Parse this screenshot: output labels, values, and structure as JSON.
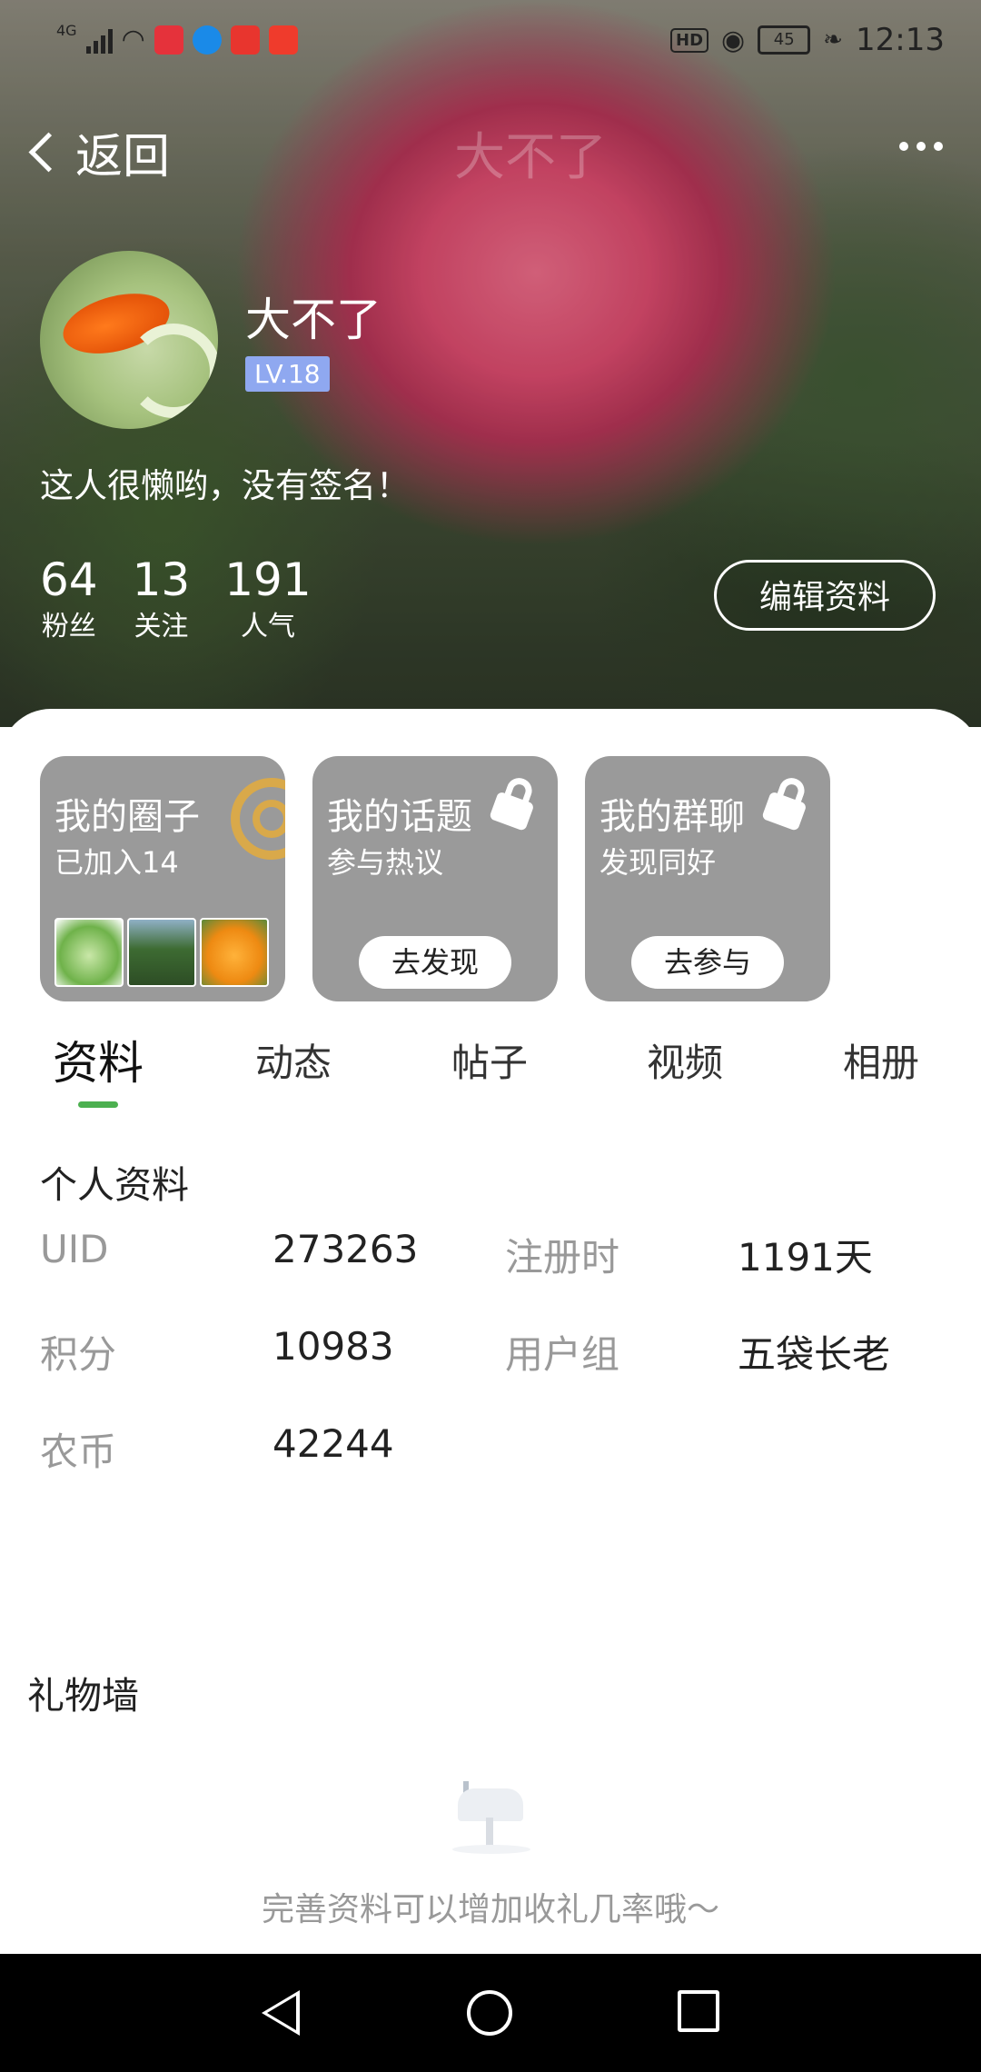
{
  "status_bar": {
    "network": "4G",
    "time": "12:13",
    "battery": "45",
    "hd": "HD",
    "app_icons": [
      "book-app-icon",
      "browser-app-icon",
      "map-pin-app-icon",
      "listen-app-icon"
    ]
  },
  "nav": {
    "back_label": "返回",
    "faded_title": "大不了"
  },
  "profile": {
    "name": "大不了",
    "level": "LV.18",
    "signature": "这人很懒哟，没有签名！",
    "stats": [
      {
        "value": "64",
        "label": "粉丝"
      },
      {
        "value": "13",
        "label": "关注"
      },
      {
        "value": "191",
        "label": "人气"
      }
    ],
    "edit_button": "编辑资料"
  },
  "cards": [
    {
      "title": "我的圈子",
      "subtitle": "已加入14"
    },
    {
      "title": "我的话题",
      "subtitle": "参与热议",
      "button": "去发现"
    },
    {
      "title": "我的群聊",
      "subtitle": "发现同好",
      "button": "去参与"
    }
  ],
  "tabs": [
    "资料",
    "动态",
    "帖子",
    "视频",
    "相册"
  ],
  "personal_info": {
    "title": "个人资料",
    "rows": [
      {
        "k1": "UID",
        "v1": "273263",
        "k2": "注册时",
        "v2": "1191天"
      },
      {
        "k1": "积分",
        "v1": "10983",
        "k2": "用户组",
        "v2": "五袋长老"
      },
      {
        "k1": "农币",
        "v1": "42244"
      }
    ]
  },
  "gift_wall": {
    "title": "礼物墙",
    "empty_text": "完善资料可以增加收礼几率哦～"
  },
  "colors": {
    "accent_green": "#4cb050",
    "level_badge": "#8fa8f0",
    "card_bg": "#9a9a9a"
  }
}
